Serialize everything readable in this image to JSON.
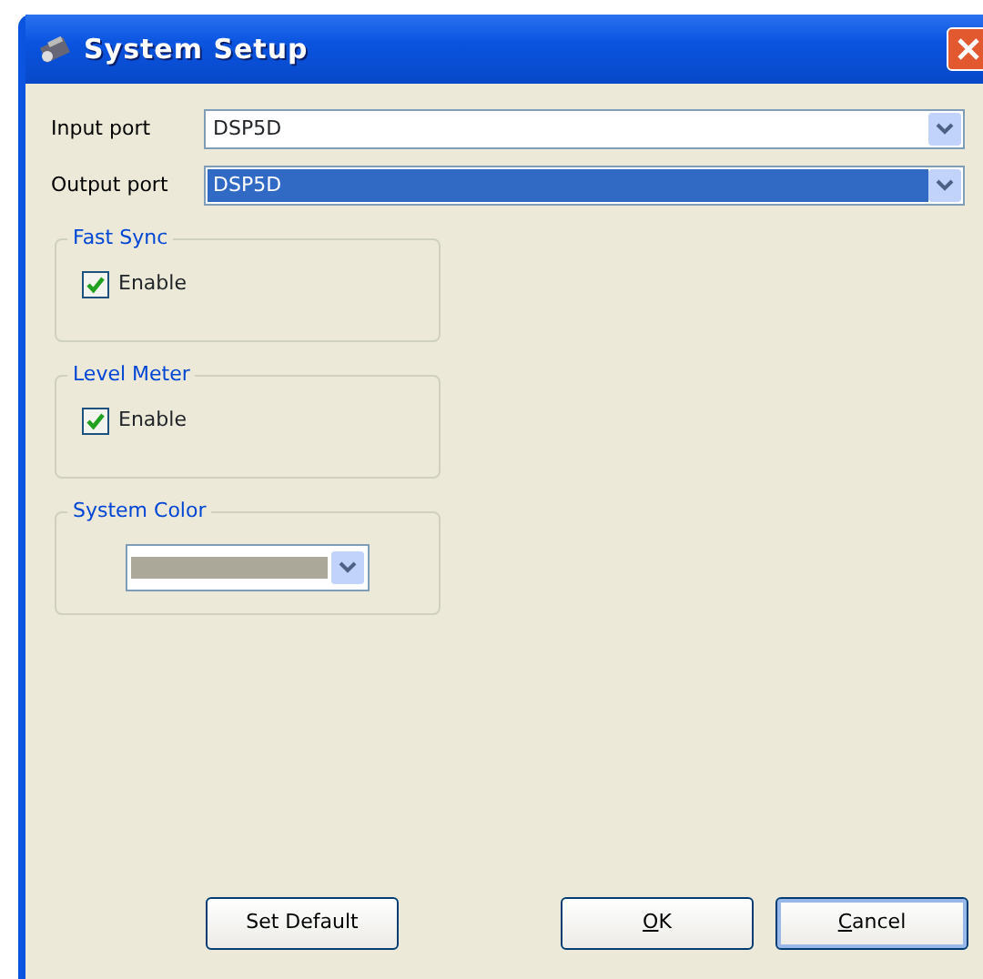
{
  "window": {
    "title": "System Setup"
  },
  "ports": [
    {
      "label": "Input port",
      "value": "DSP5D",
      "selected": false
    },
    {
      "label": "Output port",
      "value": "DSP5D",
      "selected": true
    }
  ],
  "groups": [
    {
      "title": "Fast Sync",
      "kind": "checkbox",
      "label": "Enable",
      "checked": true
    },
    {
      "title": "Level Meter",
      "kind": "checkbox",
      "label": "Enable",
      "checked": true
    },
    {
      "title": "System Color",
      "kind": "color",
      "color": "#aca899"
    }
  ],
  "buttons": [
    {
      "label": "Set Default",
      "mnemonic": false,
      "default": false
    },
    {
      "label": "OK",
      "mnemonic": true,
      "default": false
    },
    {
      "label": "Cancel",
      "mnemonic": true,
      "default": true
    }
  ]
}
